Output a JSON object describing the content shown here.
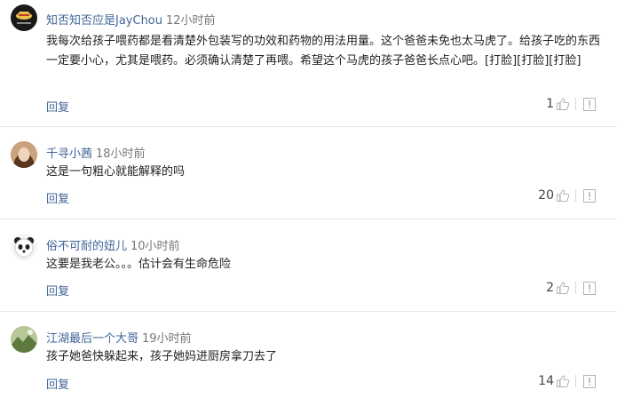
{
  "comments": [
    {
      "user": "知否知否应是JayChou",
      "time": "12小时前",
      "text": "我每次给孩子喂药都是看清楚外包装写的功效和药物的用法用量。这个爸爸未免也太马虎了。给孩子吃的东西一定要小心，尤其是喂药。必须确认清楚了再喂。希望这个马虎的孩子爸爸长点心吧。[打脸][打脸][打脸]",
      "reply_label": "回复",
      "likes": "1",
      "avatar_icon": "one-piece-straw-hat-logo"
    },
    {
      "user": "千寻小茜",
      "time": "18小时前",
      "text": "这是一句粗心就能解释的吗",
      "reply_label": "回复",
      "likes": "20",
      "avatar_icon": "girl-photo"
    },
    {
      "user": "俗不可耐的妞儿",
      "time": "10小时前",
      "text": "这要是我老公。。。估计会有生命危险",
      "reply_label": "回复",
      "likes": "2",
      "avatar_icon": "panda-cartoon"
    },
    {
      "user": "江湖最后一个大哥",
      "time": "19小时前",
      "text": "孩子她爸快躲起来，孩子她妈进厨房拿刀去了",
      "reply_label": "回复",
      "likes": "14",
      "avatar_icon": "landscape-photo"
    }
  ],
  "colors": {
    "username": "#406599",
    "reply": "#406599",
    "divider": "#e8e8e8"
  }
}
